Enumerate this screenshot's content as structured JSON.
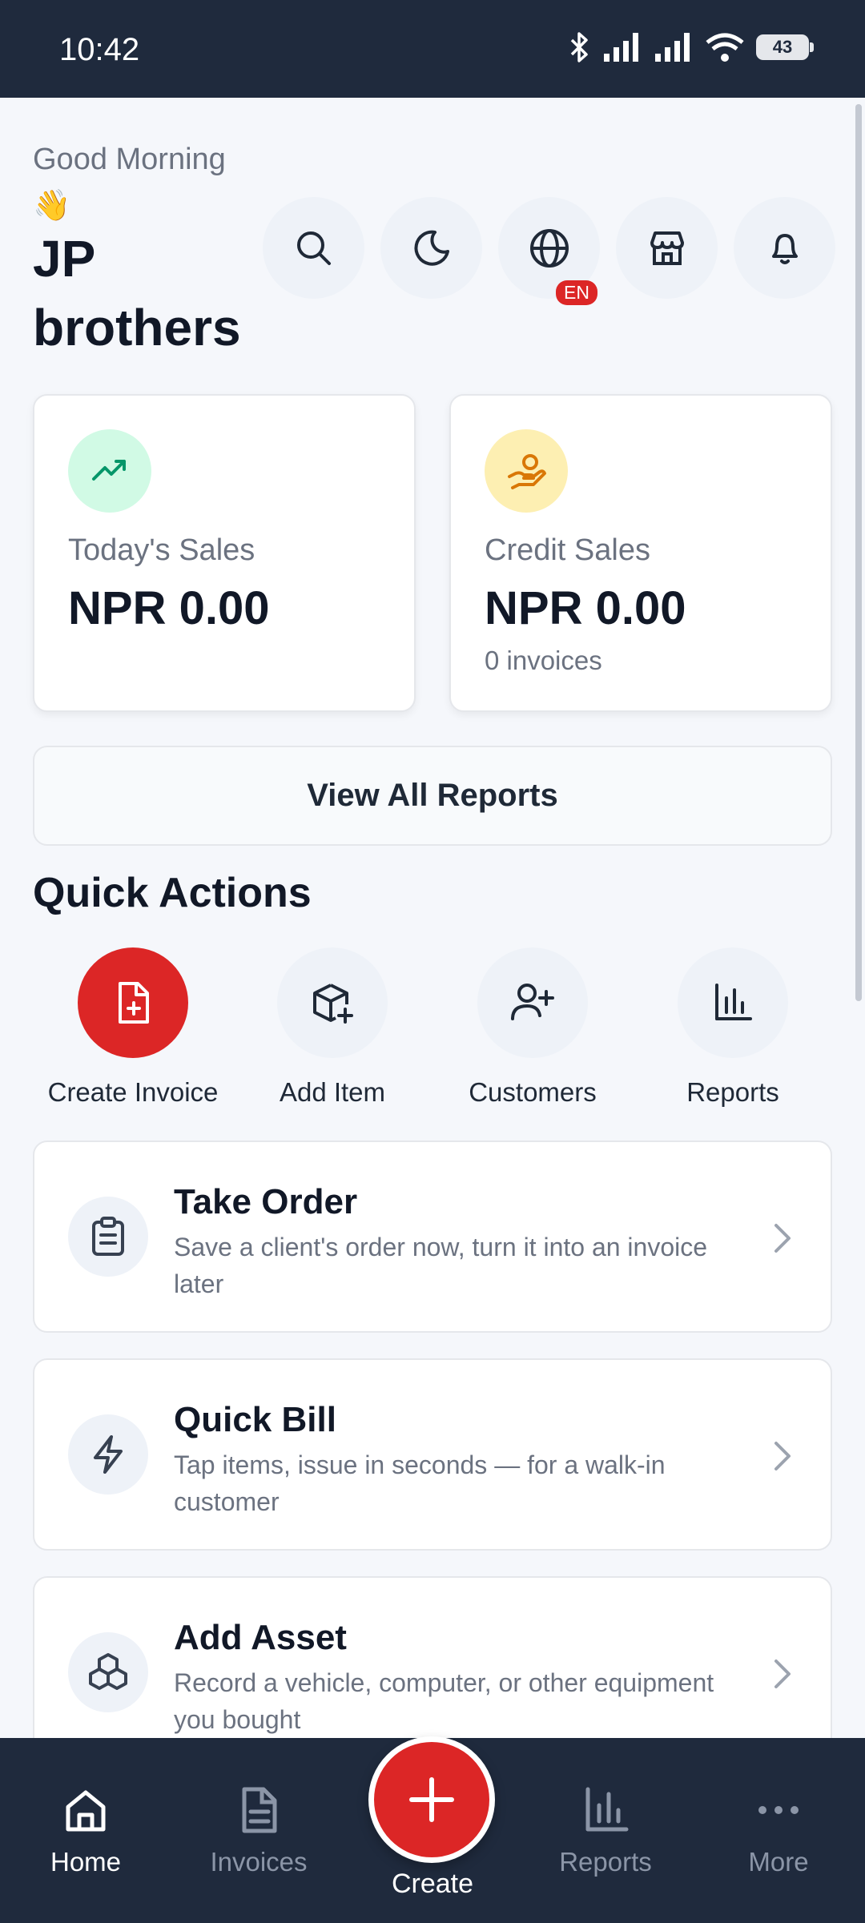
{
  "status_bar": {
    "time": "10:42",
    "battery": "43"
  },
  "header": {
    "greeting": "Good Morning 👋",
    "shop_name": "JP brothers",
    "language_badge": "EN"
  },
  "stats": {
    "today_sales": {
      "label": "Today's Sales",
      "value": "NPR 0.00"
    },
    "credit_sales": {
      "label": "Credit Sales",
      "value": "NPR 0.00",
      "sub": "0 invoices"
    }
  },
  "view_reports_label": "View All Reports",
  "quick_actions": {
    "title": "Quick Actions",
    "items": [
      {
        "label": "Create Invoice"
      },
      {
        "label": "Add Item"
      },
      {
        "label": "Customers"
      },
      {
        "label": "Reports"
      }
    ]
  },
  "cards": [
    {
      "title": "Take Order",
      "description": "Save a client's order now, turn it into an invoice later"
    },
    {
      "title": "Quick Bill",
      "description": "Tap items, issue in seconds — for a walk-in customer"
    },
    {
      "title": "Add Asset",
      "description": "Record a vehicle, computer, or other equipment you bought"
    }
  ],
  "bottom_nav": {
    "home": "Home",
    "invoices": "Invoices",
    "create": "Create",
    "reports": "Reports",
    "more": "More"
  },
  "colors": {
    "primary": "#dc2626",
    "nav_bg": "#1f2a3d",
    "sales_icon_bg": "#d1fae5",
    "credit_icon_bg": "#fdefb2"
  }
}
